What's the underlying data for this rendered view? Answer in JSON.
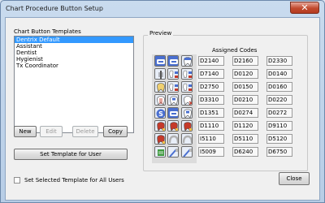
{
  "window": {
    "title": "Chart Procedure Button Setup",
    "close_glyph": "✕"
  },
  "templates": {
    "label": "Chart Button Templates",
    "items": [
      "Dentrix Default",
      "Assistant",
      "Dentist",
      "Hygienist",
      "Tx Coordinator"
    ],
    "selected_index": 0
  },
  "buttons": {
    "new": "New",
    "edit": "Edit",
    "delete": "Delete",
    "copy": "Copy",
    "set_template": "Set Template for User",
    "close": "Close"
  },
  "checkbox": {
    "label": "Set Selected Template for All Users",
    "checked": false
  },
  "preview": {
    "legend": "Preview",
    "assigned_title": "Assigned Codes",
    "icon_rows": [
      [
        "tooth-bite-icon",
        "tooth-bite-icon",
        "tooth-crown-icon"
      ],
      [
        "implant-icon",
        "tooth-exam-icon",
        "tooth-exam-icon"
      ],
      [
        "tooth-prep-icon",
        "tooth-exam-icon",
        "tooth-exam-icon"
      ],
      [
        "tooth-rct-icon",
        "tooth-filling-icon",
        "tooth-x-icon"
      ],
      [
        "sealant-s-icon",
        "tooth-bite-icon",
        "tooth-filling-icon"
      ],
      [
        "tooth-red-icon",
        "tooth-red-icon",
        "tooth-red-icon"
      ],
      [
        "tooth-red-icon",
        "denture-icon",
        "denture-icon"
      ],
      [
        "cleaning-icon",
        "brush-icon",
        "brush-icon"
      ]
    ],
    "code_rows": [
      [
        "D2140",
        "D2160",
        "D2330"
      ],
      [
        "D7140",
        "D0120",
        "D0140"
      ],
      [
        "D2750",
        "D0150",
        "D0160"
      ],
      [
        "D3310",
        "D0210",
        "D0220"
      ],
      [
        "D1351",
        "D0274",
        "D0272"
      ],
      [
        "D1110",
        "D1120",
        "D9110"
      ],
      [
        "I5110",
        "D5110",
        "D5120"
      ],
      [
        "I5009",
        "D6240",
        "D6750"
      ]
    ]
  },
  "colors": {
    "selection": "#3399ff",
    "icon_blue": "#4a6fd0",
    "icon_red": "#c53a2a",
    "icon_green": "#3f9a3f"
  }
}
